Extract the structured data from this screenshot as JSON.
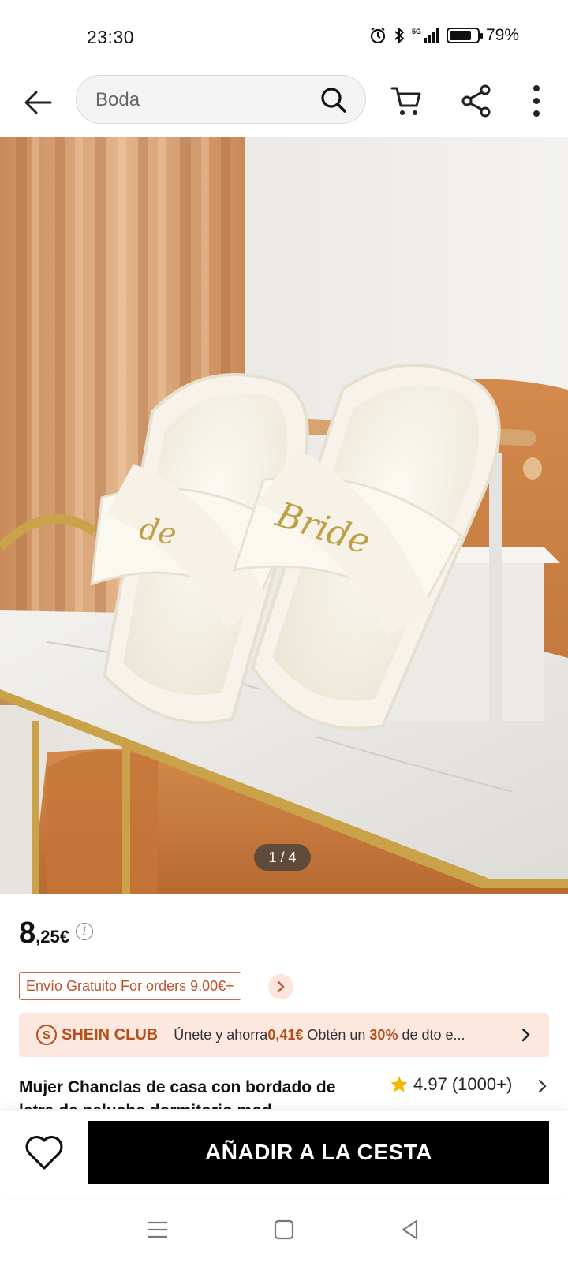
{
  "status_bar": {
    "time": "23:30",
    "network": "5G",
    "battery_percent": "79%",
    "battery_level": 0.79,
    "icons": [
      "alarm-icon",
      "bluetooth-icon",
      "signal-icon",
      "battery-icon"
    ]
  },
  "header": {
    "search_value": "Boda",
    "icons": [
      "back-arrow-icon",
      "search-icon",
      "cart-icon",
      "share-icon",
      "more-vertical-icon"
    ]
  },
  "gallery": {
    "counter": "1 / 4",
    "current": 1,
    "total": 4,
    "embroidery_text": "Bride"
  },
  "price": {
    "integer": "8",
    "decimal": ",25€",
    "info_symbol": "i"
  },
  "shipping": {
    "label": "Envío Gratuito For orders 9,00€+"
  },
  "club": {
    "badge": "S",
    "name": "SHEIN CLUB",
    "text_1": "Únete y ahorra",
    "amount": "0,41€",
    "text_2": " Obtén un ",
    "percent": "30%",
    "text_3": " de dto e..."
  },
  "product": {
    "title": "Mujer Chanclas de casa con bordado de letra de peluche dormitorio mod",
    "rating": "4.97",
    "reviews": "(1000+)"
  },
  "actions": {
    "add_to_cart": "AÑADIR A LA CESTA"
  },
  "colors": {
    "accent": "#b3501e",
    "club_bg": "#fde8df",
    "shipping_border": "#c96a45",
    "star": "#f5b800",
    "cta_bg": "#000000"
  }
}
